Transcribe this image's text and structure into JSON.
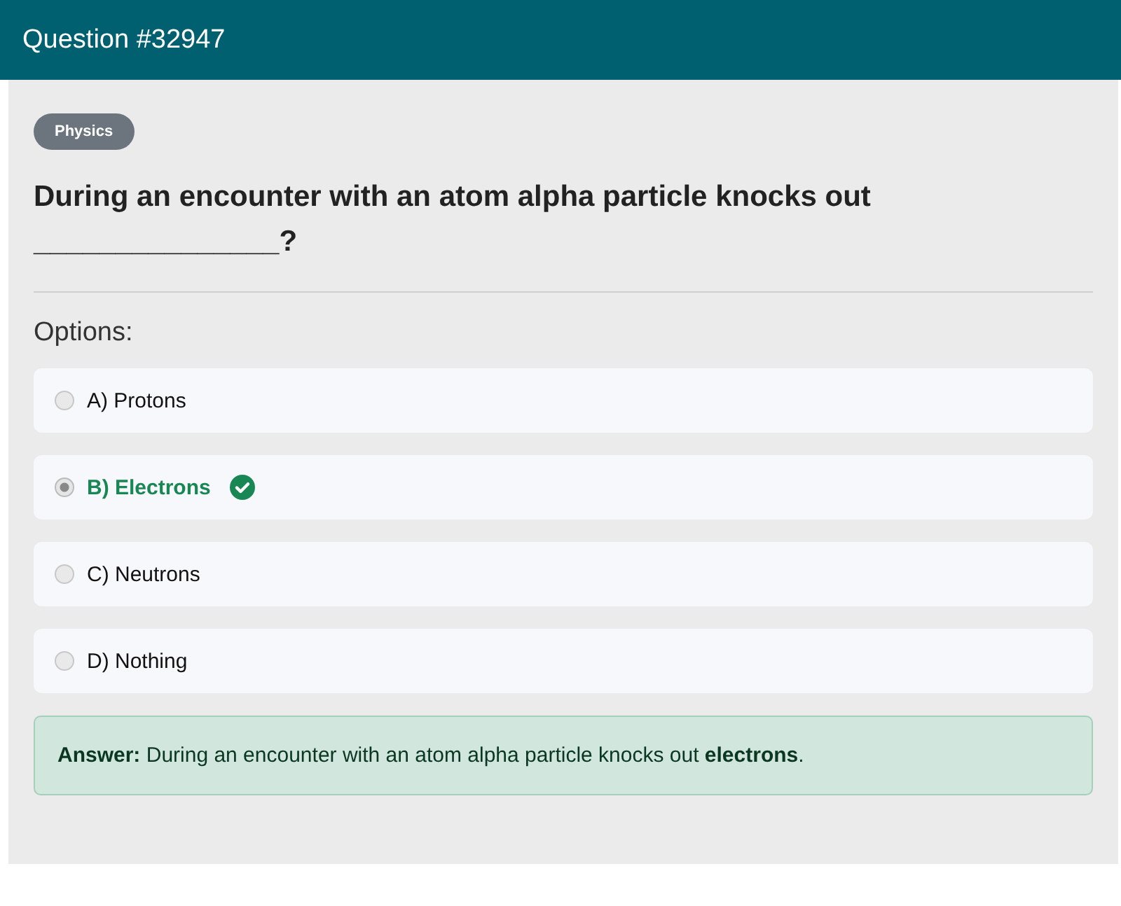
{
  "header": {
    "title": "Question #32947"
  },
  "category": "Physics",
  "question": "During an encounter with an atom alpha particle knocks out _______________?",
  "options_label": "Options:",
  "options": [
    {
      "label": "A) Protons",
      "selected": false,
      "correct": false
    },
    {
      "label": "B) Electrons",
      "selected": true,
      "correct": true
    },
    {
      "label": "C) Neutrons",
      "selected": false,
      "correct": false
    },
    {
      "label": "D) Nothing",
      "selected": false,
      "correct": false
    }
  ],
  "answer": "**Answer:** During an encounter with an atom alpha particle knocks out **electrons**."
}
